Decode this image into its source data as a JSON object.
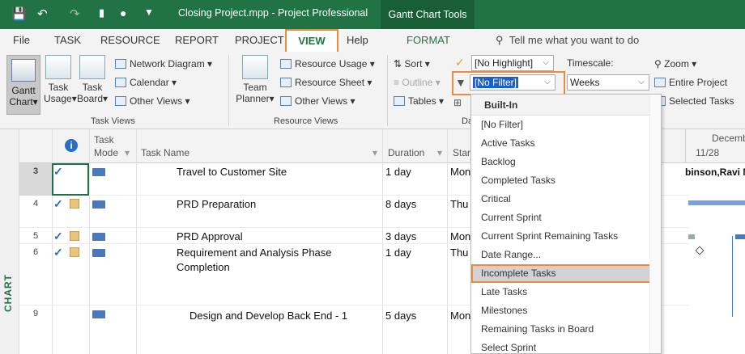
{
  "title_bar": {
    "document_title": "Closing Project.mpp  -  Project Professional",
    "context_tab": "Gantt Chart Tools",
    "save_icon": "save-icon",
    "undo_icon": "undo-icon",
    "redo_icon": "redo-icon",
    "colors": {
      "bar": "#217346",
      "context": "#1a5e38"
    }
  },
  "tabs": {
    "file": "File",
    "task": "TASK",
    "resource": "RESOURCE",
    "report": "REPORT",
    "project": "PROJECT",
    "view": "VIEW",
    "help": "Help",
    "format": "FORMAT",
    "tell_me": "Tell me what you want to do"
  },
  "ribbon": {
    "task_views": {
      "gantt_line1": "Gantt",
      "gantt_line2": "Chart",
      "task_usage_line1": "Task",
      "task_usage_line2": "Usage",
      "task_board_line1": "Task",
      "task_board_line2": "Board",
      "network_diagram": "Network Diagram",
      "calendar": "Calendar",
      "other_views": "Other Views",
      "label": "Task Views"
    },
    "resource_views": {
      "team_planner_line1": "Team",
      "team_planner_line2": "Planner",
      "resource_usage": "Resource Usage",
      "resource_sheet": "Resource Sheet",
      "other_views": "Other Views",
      "label": "Resource Views"
    },
    "data": {
      "sort": "Sort",
      "outline": "Outline",
      "tables": "Tables",
      "highlight": "[No Highlight]",
      "filter": "[No Filter]",
      "label": "Da"
    },
    "zoom": {
      "timescale_label": "Timescale:",
      "timescale_value": "Weeks",
      "zoom": "Zoom",
      "entire_project": "Entire Project",
      "selected_tasks": "Selected Tasks"
    }
  },
  "sheet": {
    "side_label": "CHART",
    "headers": {
      "task_mode_line1": "Task",
      "task_mode_line2": "Mode",
      "task_name": "Task Name",
      "duration": "Duration",
      "start": "Star"
    },
    "timeline": {
      "month": "Decemb",
      "day": "11/28",
      "resource_text": "binson,Ravi M,"
    },
    "rows": [
      {
        "id": "3",
        "name": "Travel to Customer Site",
        "duration": "1 day",
        "start": "Mon"
      },
      {
        "id": "4",
        "name": "PRD Preparation",
        "duration": "8 days",
        "start": "Thu"
      },
      {
        "id": "5",
        "name": "PRD Approval",
        "duration": "3 days",
        "start": "Mon"
      },
      {
        "id": "6",
        "name_line1": "Requirement and Analysis Phase",
        "name_line2": "Completion",
        "duration": "1 day",
        "start": "Thu"
      },
      {
        "id": "9",
        "name": "Design and Develop Back End - 1",
        "duration": "5 days",
        "start": "Mon"
      }
    ]
  },
  "filter_dropdown": {
    "header": "Built-In",
    "items": [
      "[No Filter]",
      "Active Tasks",
      "Backlog",
      "Completed Tasks",
      "Critical",
      "Current Sprint",
      "Current Sprint Remaining Tasks",
      "Date Range...",
      "Incomplete Tasks",
      "Late Tasks",
      "Milestones",
      "Remaining Tasks in Board",
      "Select Sprint"
    ],
    "highlighted_item": "Incomplete Tasks",
    "highlight_color": "#f08a3a"
  }
}
